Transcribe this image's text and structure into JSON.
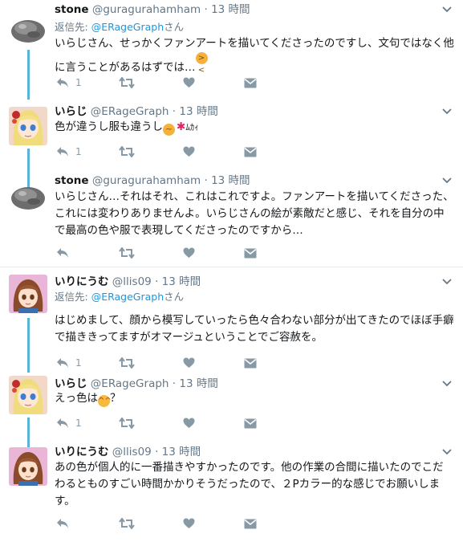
{
  "tweets": [
    {
      "name": "stone",
      "handle": "@guragurahamham",
      "time": "13 時間",
      "reply_prefix": "返信先: ",
      "reply_to": "@ERageGraph",
      "reply_suffix": "さん",
      "text": "いらじさん、せっかくファンアートを描いてくださったのですし、文句ではなく他に言うことがあるはずでは…",
      "emoji": "confounded-face",
      "reply_count": "1"
    },
    {
      "name": "いらじ",
      "handle": "@ERageGraph",
      "time": "13 時間",
      "text": "色が違うし服も違うし",
      "emoji_text": "ﾑｶｨ",
      "reply_count": "1"
    },
    {
      "name": "stone",
      "handle": "@guragurahamham",
      "time": "13 時間",
      "text": "いらじさん…それはそれ、これはこれですよ。ファンアートを描いてくださった、これには変わりありませんよ。いらじさんの絵が素敵だと感じ、それを自分の中で最高の色や服で表現してくださったのですから…",
      "reply_count": ""
    },
    {
      "name": "いりにうむ",
      "handle": "@llis09",
      "time": "13 時間",
      "reply_prefix": "返信先: ",
      "reply_to": "@ERageGraph",
      "reply_suffix": "さん",
      "text": "はじめまして、顔から模写していったら色々合わない部分が出てきたのでほぼ手癖で描ききってますがオマージュということでご容赦を。",
      "reply_count": "1"
    },
    {
      "name": "いらじ",
      "handle": "@ERageGraph",
      "time": "13 時間",
      "text_before": "えっ色は",
      "text_after": "？",
      "reply_count": "1"
    },
    {
      "name": "いりにうむ",
      "handle": "@llis09",
      "time": "13 時間",
      "text": "あの色が個人的に一番描きやすかったのです。他の作業の合間に描いたのでこだわるとものすごい時間かかりそうだったので、２Pカラー的な感じでお願いします。",
      "reply_count": ""
    }
  ],
  "colors": {
    "link": "#1b95e0",
    "thread_line": "#5bb4d6",
    "meta": "#657786",
    "action": "#8899a6"
  }
}
